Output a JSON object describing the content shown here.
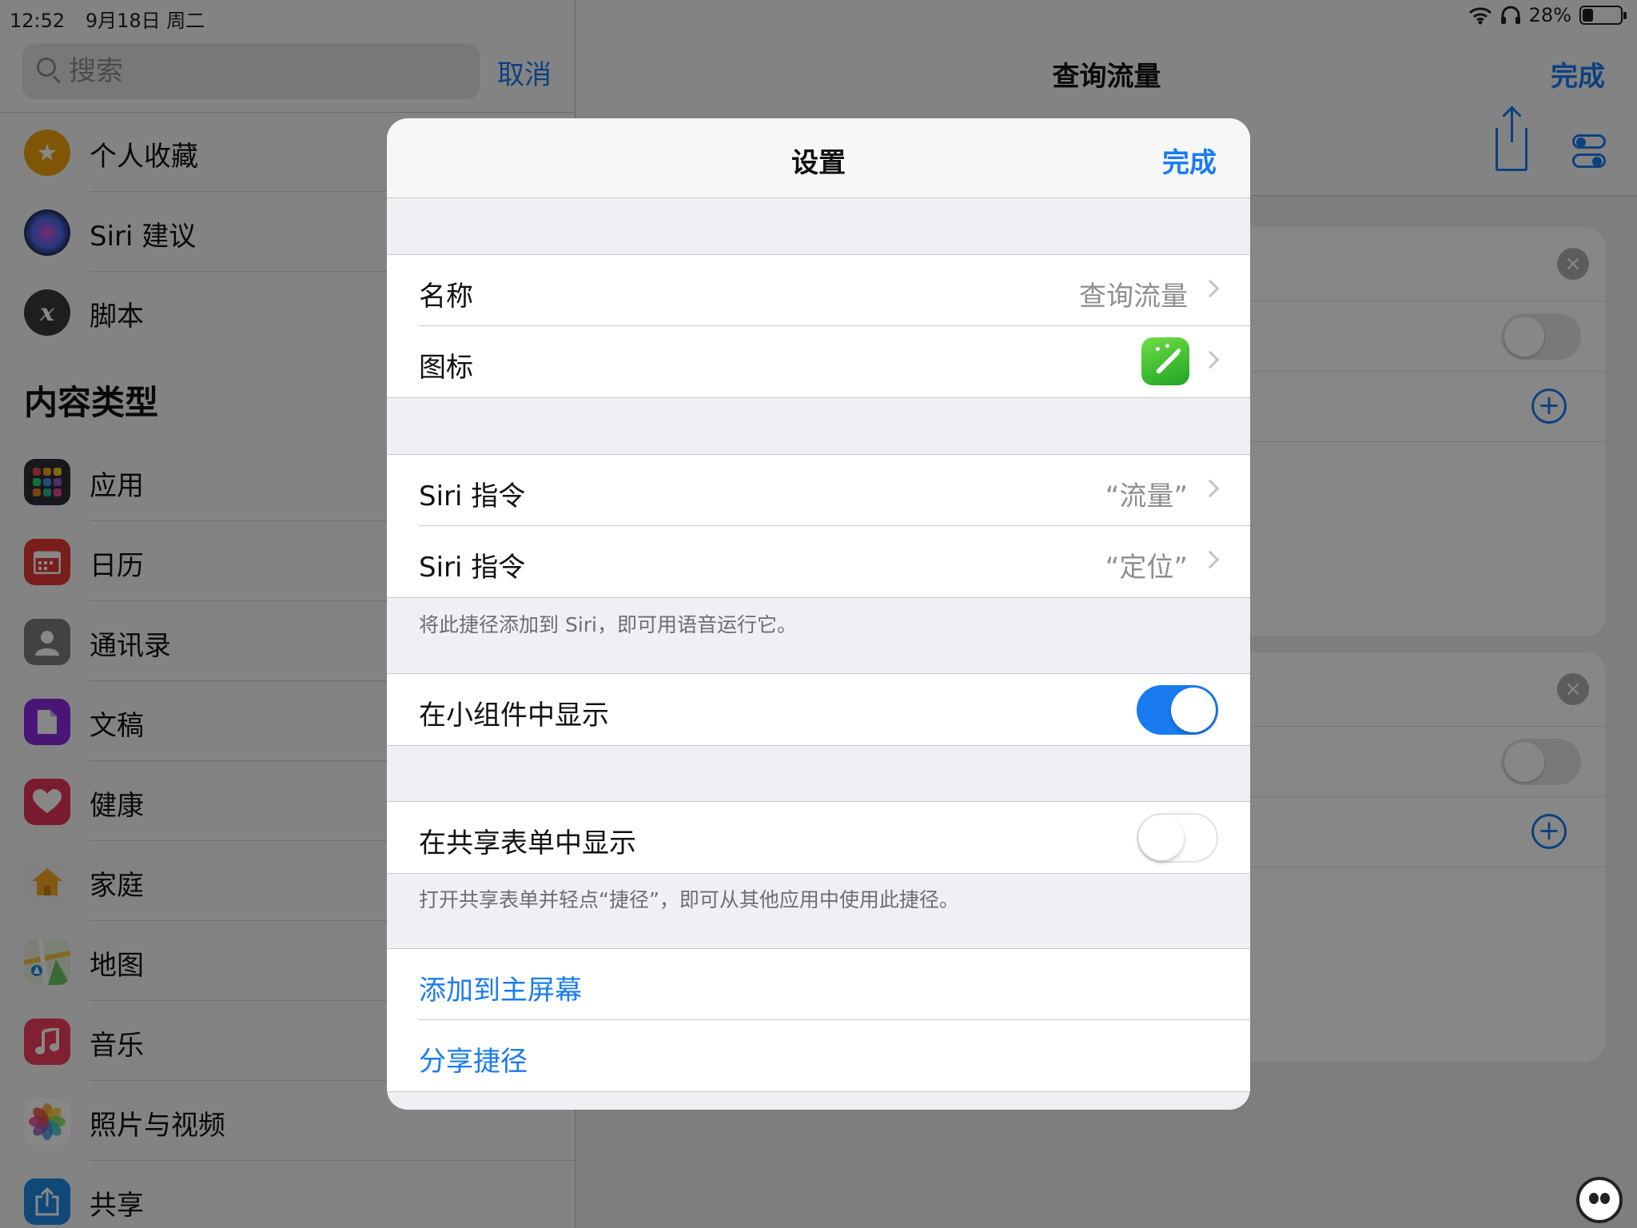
{
  "status_bar": {
    "time": "12:52",
    "date": "9月18日 周二",
    "battery": "28%",
    "battery_level": 0.28
  },
  "sidebar": {
    "search": {
      "placeholder": "搜索"
    },
    "cancel_label": "取消",
    "top_items": [
      {
        "label": "个人收藏",
        "icon": "star-icon",
        "color": "#f0a30a"
      },
      {
        "label": "Siri 建议",
        "icon": "siri-icon",
        "color": "#3a3a5c"
      },
      {
        "label": "脚本",
        "icon": "script-x-icon",
        "color": "#3a3a3c"
      }
    ],
    "section_title": "内容类型",
    "content_items": [
      {
        "label": "应用",
        "icon": "apps-grid-icon",
        "color": "#2c2c3a"
      },
      {
        "label": "日历",
        "icon": "calendar-icon",
        "color": "#e53935"
      },
      {
        "label": "通讯录",
        "icon": "contacts-icon",
        "color": "#7d7d82"
      },
      {
        "label": "文稿",
        "icon": "document-icon",
        "color": "#8a2be2"
      },
      {
        "label": "健康",
        "icon": "heart-icon",
        "color": "#e8345a"
      },
      {
        "label": "家庭",
        "icon": "home-icon",
        "color": "#f5a623"
      },
      {
        "label": "地图",
        "icon": "maps-icon",
        "color": "#4caf50"
      },
      {
        "label": "音乐",
        "icon": "music-icon",
        "color": "#f23d5c"
      },
      {
        "label": "照片与视频",
        "icon": "photos-icon",
        "color": "#ffffff"
      },
      {
        "label": "共享",
        "icon": "share-icon",
        "color": "#1e88e5"
      }
    ]
  },
  "main": {
    "title": "查询流量",
    "done_label": "完成"
  },
  "modal": {
    "title": "设置",
    "done_label": "完成",
    "name_row": {
      "label": "名称",
      "value": "查询流量"
    },
    "icon_row": {
      "label": "图标",
      "icon": "magic-wand-icon",
      "icon_color": "#34b233"
    },
    "siri_rows": [
      {
        "label": "Siri 指令",
        "value": "“流量”"
      },
      {
        "label": "Siri 指令",
        "value": "“定位”"
      }
    ],
    "siri_note": "将此捷径添加到 Siri，即可用语音运行它。",
    "widget_row": {
      "label": "在小组件中显示",
      "on": true
    },
    "share_sheet_row": {
      "label": "在共享表单中显示",
      "on": false
    },
    "share_sheet_note": "打开共享表单并轻点“捷径”，即可从其他应用中使用此捷径。",
    "actions": [
      {
        "label": "添加到主屏幕"
      },
      {
        "label": "分享捷径"
      }
    ]
  },
  "colors": {
    "accent": "#1a7bf0",
    "toggle_on": "#1a7bf0"
  }
}
